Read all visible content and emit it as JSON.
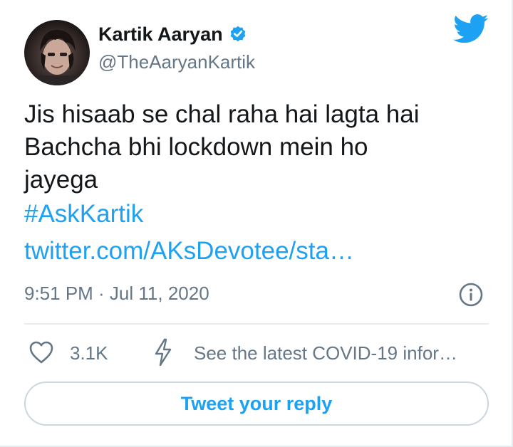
{
  "author": {
    "display_name": "Kartik Aaryan",
    "handle": "@TheAaryanKartik",
    "verified": true,
    "avatar_icon": "profile-photo"
  },
  "tweet": {
    "text_lines": [
      "Jis hisaab se chal raha hai lagta hai",
      "Bachcha bhi lockdown mein ho",
      "jayega"
    ],
    "hashtag": "#AskKartik",
    "link": "twitter.com/AKsDevotee/sta…",
    "timestamp": "9:51 PM · Jul 11, 2020"
  },
  "actions": {
    "like_count": "3.1K",
    "covid_notice": "See the latest COVID-19 infor…",
    "reply_label": "Tweet your reply"
  },
  "colors": {
    "accent": "#1da1f2",
    "text_primary": "#14171a",
    "text_secondary": "#657786",
    "divider": "#e6ecf0"
  },
  "icons": {
    "brand": "twitter-bird-icon",
    "verified": "verified-badge-icon",
    "info": "info-icon",
    "like": "heart-icon",
    "covid": "lightning-bolt-icon"
  }
}
